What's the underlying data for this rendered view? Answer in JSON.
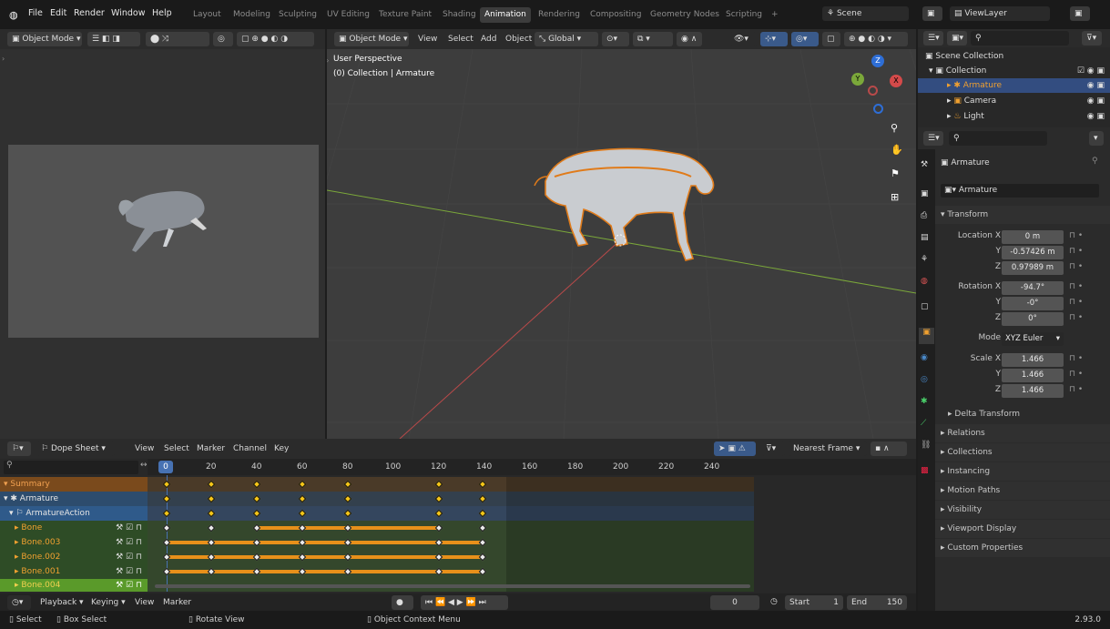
{
  "topmenu": {
    "file": "File",
    "edit": "Edit",
    "render": "Render",
    "window": "Window",
    "help": "Help"
  },
  "workspaces": [
    "Layout",
    "Modeling",
    "Sculpting",
    "UV Editing",
    "Texture Paint",
    "Shading",
    "Animation",
    "Rendering",
    "Compositing",
    "Geometry Nodes",
    "Scripting",
    "+"
  ],
  "scene": "Scene",
  "view_layer": "ViewLayer",
  "left_header": {
    "mode": "Object Mode"
  },
  "viewport": {
    "mode": "Object Mode",
    "view": "View",
    "select": "Select",
    "add": "Add",
    "object": "Object",
    "orientation": "Global",
    "overlay_title": "User Perspective",
    "overlay_subtitle": "(0) Collection | Armature",
    "gizmo_x": "X",
    "gizmo_y": "Y",
    "gizmo_z": "Z"
  },
  "outliner": {
    "root": "Scene Collection",
    "collection": "Collection",
    "items": [
      "Armature",
      "Camera",
      "Light"
    ]
  },
  "properties": {
    "object_name": "Armature",
    "datablock": "Armature",
    "transform": "Transform",
    "location_x_label": "Location X",
    "location": [
      "0 m",
      "-0.57426 m",
      "0.97989 m"
    ],
    "rotation_x_label": "Rotation X",
    "rotation": [
      "-94.7°",
      "-0°",
      "0°"
    ],
    "mode_label": "Mode",
    "mode": "XYZ Euler",
    "scale_x_label": "Scale X",
    "scale": [
      "1.466",
      "1.466",
      "1.466"
    ],
    "y": "Y",
    "z": "Z",
    "delta": "Delta Transform",
    "sections": [
      "Relations",
      "Collections",
      "Instancing",
      "Motion Paths",
      "Visibility",
      "Viewport Display",
      "Custom Properties"
    ]
  },
  "dopesheet": {
    "editor": "Dope Sheet",
    "view": "View",
    "select": "Select",
    "marker": "Marker",
    "channel": "Channel",
    "key": "Key",
    "snap": "Nearest Frame",
    "current_frame": "0",
    "ticks": [
      "20",
      "40",
      "60",
      "80",
      "100",
      "120",
      "140",
      "160",
      "180",
      "200",
      "220",
      "240"
    ],
    "channels": [
      {
        "name": "Summary",
        "color": "#7a4a1c"
      },
      {
        "name": "Armature",
        "color": "#2d4c6d"
      },
      {
        "name": "ArmatureAction",
        "color": "#2f5a8a"
      },
      {
        "name": "Bone",
        "color": "#2e4c26"
      },
      {
        "name": "Bone.003",
        "color": "#2e4c26"
      },
      {
        "name": "Bone.002",
        "color": "#2e4c26"
      },
      {
        "name": "Bone.001",
        "color": "#2e4c26"
      },
      {
        "name": "Bone.004",
        "color": "#5a9a2a"
      }
    ]
  },
  "playback": {
    "playback": "Playback",
    "keying": "Keying",
    "view": "View",
    "marker": "Marker",
    "frame": "0",
    "start_label": "Start",
    "start": "1",
    "end_label": "End",
    "end": "150"
  },
  "status": {
    "select": "Select",
    "box": "Box Select",
    "rotate": "Rotate View",
    "context": "Object Context Menu",
    "version": "2.93.0"
  },
  "colors": {
    "accent": "#4772b3",
    "orange": "#e8901a",
    "keyframe": "#f5c518",
    "x_axis": "#b84a4a",
    "y_axis": "#7ba83a"
  }
}
